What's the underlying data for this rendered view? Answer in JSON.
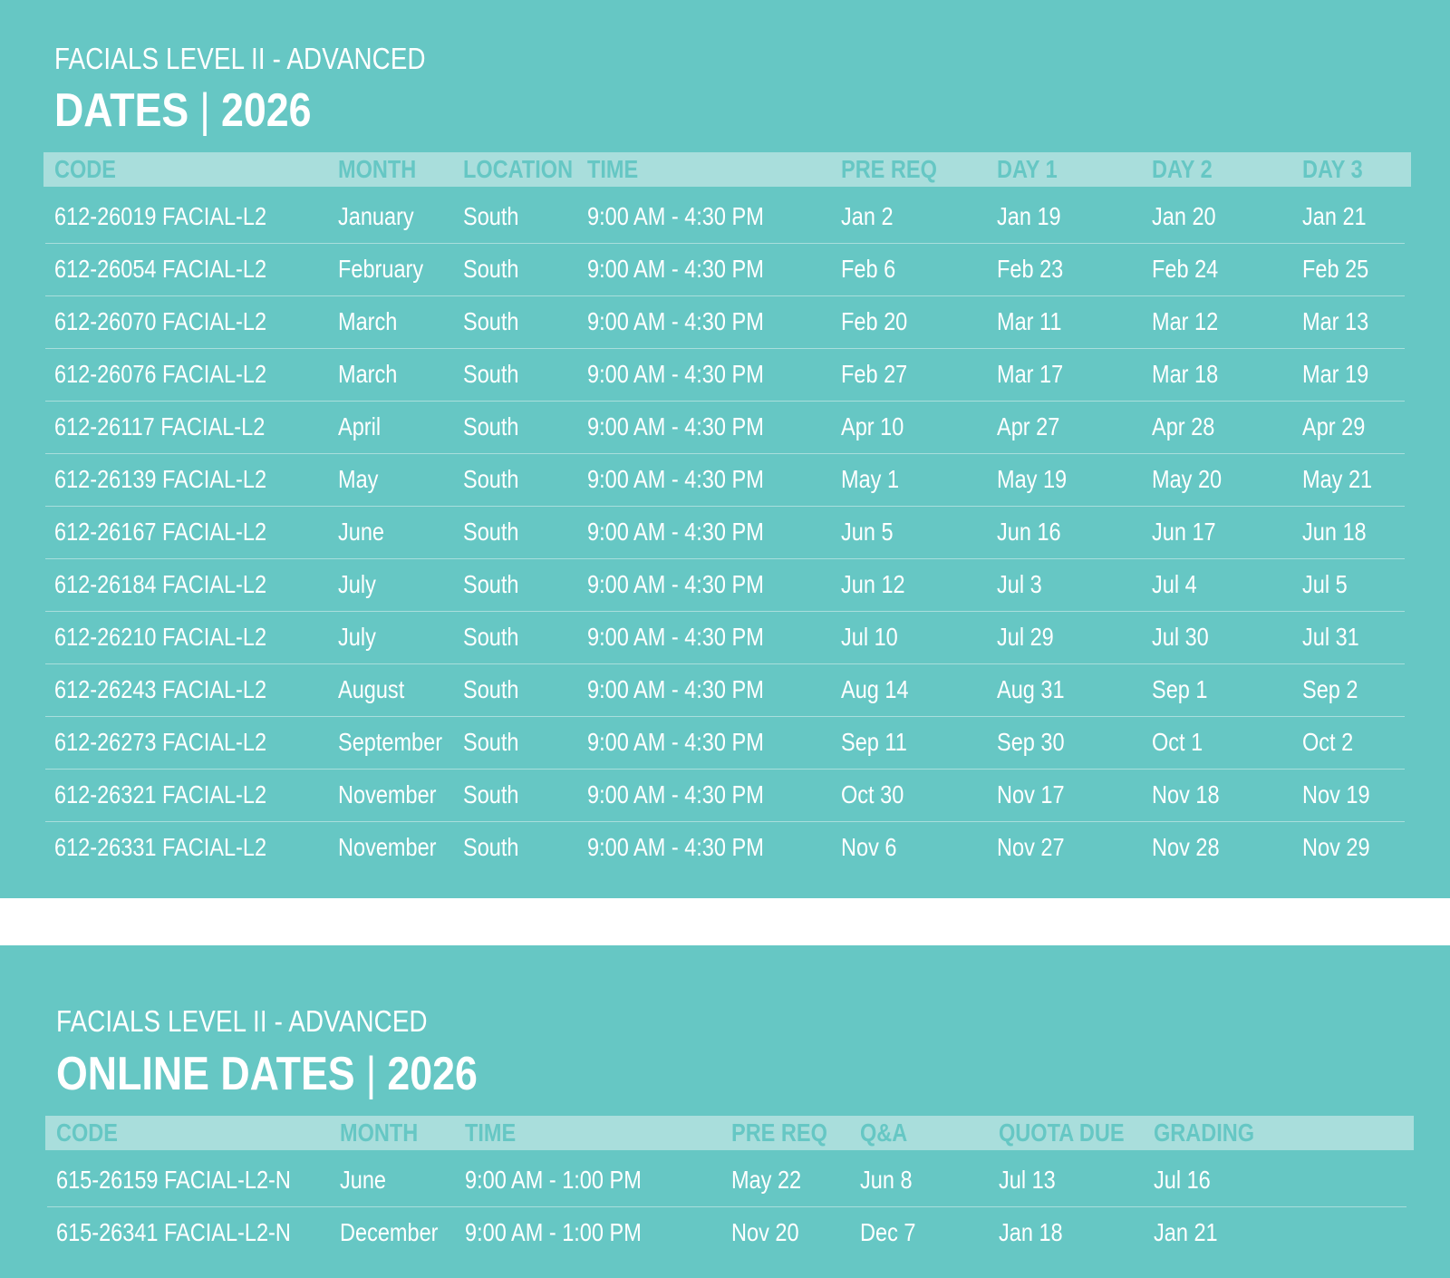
{
  "inperson": {
    "subtitle": "FACIALS LEVEL II - ADVANCED",
    "title_left": "DATES",
    "title_sep": "|",
    "title_year": "2026",
    "headers": {
      "code": "CODE",
      "month": "MONTH",
      "location": "LOCATION",
      "time": "TIME",
      "prereq": "PRE REQ",
      "day1": "DAY 1",
      "day2": "DAY 2",
      "day3": "DAY 3"
    },
    "rows": [
      {
        "code": "612-26019 FACIAL-L2",
        "month": "January",
        "location": "South",
        "time": "9:00 AM - 4:30 PM",
        "prereq": "Jan 2",
        "day1": "Jan 19",
        "day2": "Jan 20",
        "day3": "Jan 21"
      },
      {
        "code": "612-26054 FACIAL-L2",
        "month": "February",
        "location": "South",
        "time": "9:00 AM - 4:30 PM",
        "prereq": "Feb 6",
        "day1": "Feb 23",
        "day2": "Feb 24",
        "day3": "Feb 25"
      },
      {
        "code": "612-26070 FACIAL-L2",
        "month": "March",
        "location": "South",
        "time": "9:00 AM - 4:30 PM",
        "prereq": "Feb 20",
        "day1": "Mar 11",
        "day2": "Mar 12",
        "day3": "Mar 13"
      },
      {
        "code": "612-26076 FACIAL-L2",
        "month": "March",
        "location": "South",
        "time": "9:00 AM - 4:30 PM",
        "prereq": "Feb 27",
        "day1": "Mar 17",
        "day2": "Mar 18",
        "day3": "Mar 19"
      },
      {
        "code": "612-26117 FACIAL-L2",
        "month": "April",
        "location": "South",
        "time": "9:00 AM - 4:30 PM",
        "prereq": "Apr 10",
        "day1": "Apr 27",
        "day2": "Apr 28",
        "day3": "Apr 29"
      },
      {
        "code": "612-26139 FACIAL-L2",
        "month": "May",
        "location": "South",
        "time": "9:00 AM - 4:30 PM",
        "prereq": "May 1",
        "day1": "May 19",
        "day2": "May 20",
        "day3": "May 21"
      },
      {
        "code": "612-26167 FACIAL-L2",
        "month": "June",
        "location": "South",
        "time": "9:00 AM - 4:30 PM",
        "prereq": "Jun 5",
        "day1": "Jun 16",
        "day2": "Jun 17",
        "day3": "Jun 18"
      },
      {
        "code": "612-26184 FACIAL-L2",
        "month": "July",
        "location": "South",
        "time": "9:00 AM - 4:30 PM",
        "prereq": "Jun 12",
        "day1": "Jul 3",
        "day2": "Jul 4",
        "day3": "Jul 5"
      },
      {
        "code": "612-26210 FACIAL-L2",
        "month": "July",
        "location": "South",
        "time": "9:00 AM - 4:30 PM",
        "prereq": "Jul 10",
        "day1": "Jul 29",
        "day2": "Jul 30",
        "day3": "Jul 31"
      },
      {
        "code": "612-26243 FACIAL-L2",
        "month": "August",
        "location": "South",
        "time": "9:00 AM - 4:30 PM",
        "prereq": "Aug 14",
        "day1": "Aug 31",
        "day2": "Sep 1",
        "day3": "Sep 2"
      },
      {
        "code": "612-26273 FACIAL-L2",
        "month": "September",
        "location": "South",
        "time": "9:00 AM - 4:30 PM",
        "prereq": "Sep 11",
        "day1": "Sep 30",
        "day2": "Oct 1",
        "day3": "Oct 2"
      },
      {
        "code": "612-26321 FACIAL-L2",
        "month": "November",
        "location": "South",
        "time": "9:00 AM - 4:30 PM",
        "prereq": "Oct 30",
        "day1": "Nov 17",
        "day2": "Nov 18",
        "day3": "Nov 19"
      },
      {
        "code": "612-26331 FACIAL-L2",
        "month": "November",
        "location": "South",
        "time": "9:00 AM - 4:30 PM",
        "prereq": "Nov 6",
        "day1": "Nov 27",
        "day2": "Nov 28",
        "day3": "Nov 29"
      }
    ]
  },
  "online": {
    "subtitle": "FACIALS LEVEL II - ADVANCED",
    "title_left": "ONLINE DATES",
    "title_sep": "|",
    "title_year": "2026",
    "headers": {
      "code": "CODE",
      "month": "MONTH",
      "time": "TIME",
      "prereq": "PRE REQ",
      "qa": "Q&A",
      "quota": "QUOTA DUE",
      "grading": "GRADING"
    },
    "rows": [
      {
        "code": "615-26159 FACIAL-L2-N",
        "month": "June",
        "time": "9:00 AM - 1:00 PM",
        "prereq": "May 22",
        "qa": "Jun 8",
        "quota": "Jul 13",
        "grading": "Jul 16"
      },
      {
        "code": "615-26341 FACIAL-L2-N",
        "month": "December",
        "time": "9:00 AM - 1:00 PM",
        "prereq": "Nov 20",
        "qa": "Dec 7",
        "quota": "Jan 18",
        "grading": "Jan 21"
      }
    ]
  },
  "colors": {
    "panel": "#66c7c4",
    "header_bar": "#a9dedc",
    "text": "#ffffff",
    "gap": "#ffffff"
  }
}
